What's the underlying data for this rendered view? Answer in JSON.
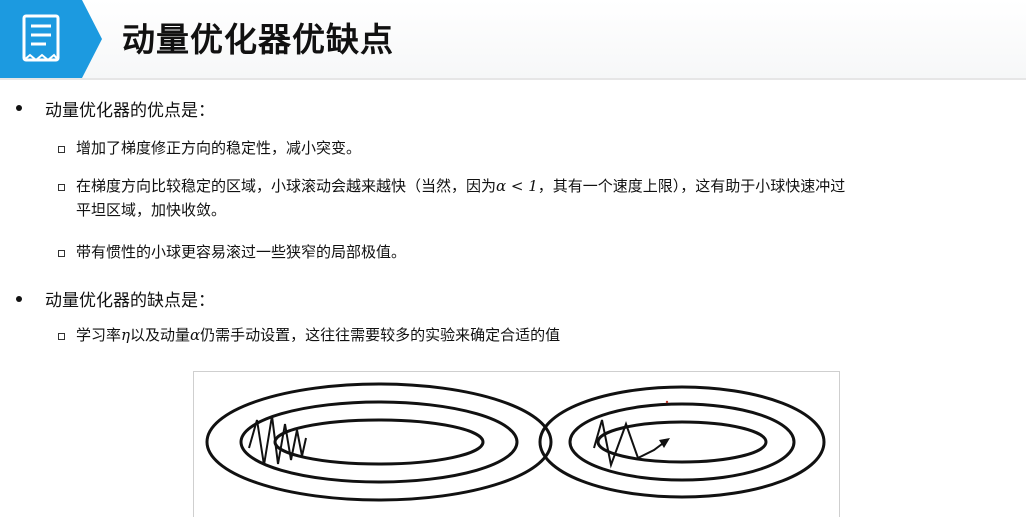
{
  "header": {
    "title": "动量优化器优缺点",
    "icon": "document-list-icon",
    "accent_color": "#1c9ae0"
  },
  "pros": {
    "heading": "动量优化器的优点是：",
    "items": [
      {
        "text": "增加了梯度修正方向的稳定性，减小突变。"
      },
      {
        "line1_before": "在梯度方向比较稳定的区域，小球滚动会越来越快（当然，因为",
        "math": "α < 1",
        "line1_after": "，其有一个速度上限），这有助于小球快速冲过",
        "line2": "平坦区域，加快收敛。"
      },
      {
        "text": "带有惯性的小球更容易滚过一些狭窄的局部极值。"
      }
    ]
  },
  "cons": {
    "heading": "动量优化器的缺点是：",
    "items": [
      {
        "part1": "学习率",
        "math1": "η",
        "part2": "以及动量",
        "math2": "α",
        "part3": "仍需手动设置，这往往需要较多的实验来确定合适的值"
      }
    ]
  },
  "figure": {
    "description_icons": [
      "contour-ellipses-left",
      "contour-ellipses-right"
    ]
  }
}
